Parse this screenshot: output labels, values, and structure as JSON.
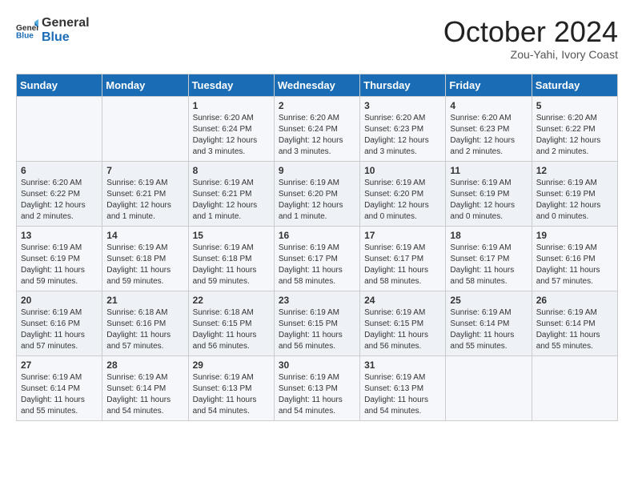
{
  "logo": {
    "line1": "General",
    "line2": "Blue"
  },
  "title": "October 2024",
  "location": "Zou-Yahi, Ivory Coast",
  "weekdays": [
    "Sunday",
    "Monday",
    "Tuesday",
    "Wednesday",
    "Thursday",
    "Friday",
    "Saturday"
  ],
  "weeks": [
    [
      {
        "day": "",
        "info": ""
      },
      {
        "day": "",
        "info": ""
      },
      {
        "day": "1",
        "info": "Sunrise: 6:20 AM\nSunset: 6:24 PM\nDaylight: 12 hours and 3 minutes."
      },
      {
        "day": "2",
        "info": "Sunrise: 6:20 AM\nSunset: 6:24 PM\nDaylight: 12 hours and 3 minutes."
      },
      {
        "day": "3",
        "info": "Sunrise: 6:20 AM\nSunset: 6:23 PM\nDaylight: 12 hours and 3 minutes."
      },
      {
        "day": "4",
        "info": "Sunrise: 6:20 AM\nSunset: 6:23 PM\nDaylight: 12 hours and 2 minutes."
      },
      {
        "day": "5",
        "info": "Sunrise: 6:20 AM\nSunset: 6:22 PM\nDaylight: 12 hours and 2 minutes."
      }
    ],
    [
      {
        "day": "6",
        "info": "Sunrise: 6:20 AM\nSunset: 6:22 PM\nDaylight: 12 hours and 2 minutes."
      },
      {
        "day": "7",
        "info": "Sunrise: 6:19 AM\nSunset: 6:21 PM\nDaylight: 12 hours and 1 minute."
      },
      {
        "day": "8",
        "info": "Sunrise: 6:19 AM\nSunset: 6:21 PM\nDaylight: 12 hours and 1 minute."
      },
      {
        "day": "9",
        "info": "Sunrise: 6:19 AM\nSunset: 6:20 PM\nDaylight: 12 hours and 1 minute."
      },
      {
        "day": "10",
        "info": "Sunrise: 6:19 AM\nSunset: 6:20 PM\nDaylight: 12 hours and 0 minutes."
      },
      {
        "day": "11",
        "info": "Sunrise: 6:19 AM\nSunset: 6:19 PM\nDaylight: 12 hours and 0 minutes."
      },
      {
        "day": "12",
        "info": "Sunrise: 6:19 AM\nSunset: 6:19 PM\nDaylight: 12 hours and 0 minutes."
      }
    ],
    [
      {
        "day": "13",
        "info": "Sunrise: 6:19 AM\nSunset: 6:19 PM\nDaylight: 11 hours and 59 minutes."
      },
      {
        "day": "14",
        "info": "Sunrise: 6:19 AM\nSunset: 6:18 PM\nDaylight: 11 hours and 59 minutes."
      },
      {
        "day": "15",
        "info": "Sunrise: 6:19 AM\nSunset: 6:18 PM\nDaylight: 11 hours and 59 minutes."
      },
      {
        "day": "16",
        "info": "Sunrise: 6:19 AM\nSunset: 6:17 PM\nDaylight: 11 hours and 58 minutes."
      },
      {
        "day": "17",
        "info": "Sunrise: 6:19 AM\nSunset: 6:17 PM\nDaylight: 11 hours and 58 minutes."
      },
      {
        "day": "18",
        "info": "Sunrise: 6:19 AM\nSunset: 6:17 PM\nDaylight: 11 hours and 58 minutes."
      },
      {
        "day": "19",
        "info": "Sunrise: 6:19 AM\nSunset: 6:16 PM\nDaylight: 11 hours and 57 minutes."
      }
    ],
    [
      {
        "day": "20",
        "info": "Sunrise: 6:19 AM\nSunset: 6:16 PM\nDaylight: 11 hours and 57 minutes."
      },
      {
        "day": "21",
        "info": "Sunrise: 6:18 AM\nSunset: 6:16 PM\nDaylight: 11 hours and 57 minutes."
      },
      {
        "day": "22",
        "info": "Sunrise: 6:18 AM\nSunset: 6:15 PM\nDaylight: 11 hours and 56 minutes."
      },
      {
        "day": "23",
        "info": "Sunrise: 6:19 AM\nSunset: 6:15 PM\nDaylight: 11 hours and 56 minutes."
      },
      {
        "day": "24",
        "info": "Sunrise: 6:19 AM\nSunset: 6:15 PM\nDaylight: 11 hours and 56 minutes."
      },
      {
        "day": "25",
        "info": "Sunrise: 6:19 AM\nSunset: 6:14 PM\nDaylight: 11 hours and 55 minutes."
      },
      {
        "day": "26",
        "info": "Sunrise: 6:19 AM\nSunset: 6:14 PM\nDaylight: 11 hours and 55 minutes."
      }
    ],
    [
      {
        "day": "27",
        "info": "Sunrise: 6:19 AM\nSunset: 6:14 PM\nDaylight: 11 hours and 55 minutes."
      },
      {
        "day": "28",
        "info": "Sunrise: 6:19 AM\nSunset: 6:14 PM\nDaylight: 11 hours and 54 minutes."
      },
      {
        "day": "29",
        "info": "Sunrise: 6:19 AM\nSunset: 6:13 PM\nDaylight: 11 hours and 54 minutes."
      },
      {
        "day": "30",
        "info": "Sunrise: 6:19 AM\nSunset: 6:13 PM\nDaylight: 11 hours and 54 minutes."
      },
      {
        "day": "31",
        "info": "Sunrise: 6:19 AM\nSunset: 6:13 PM\nDaylight: 11 hours and 54 minutes."
      },
      {
        "day": "",
        "info": ""
      },
      {
        "day": "",
        "info": ""
      }
    ]
  ]
}
